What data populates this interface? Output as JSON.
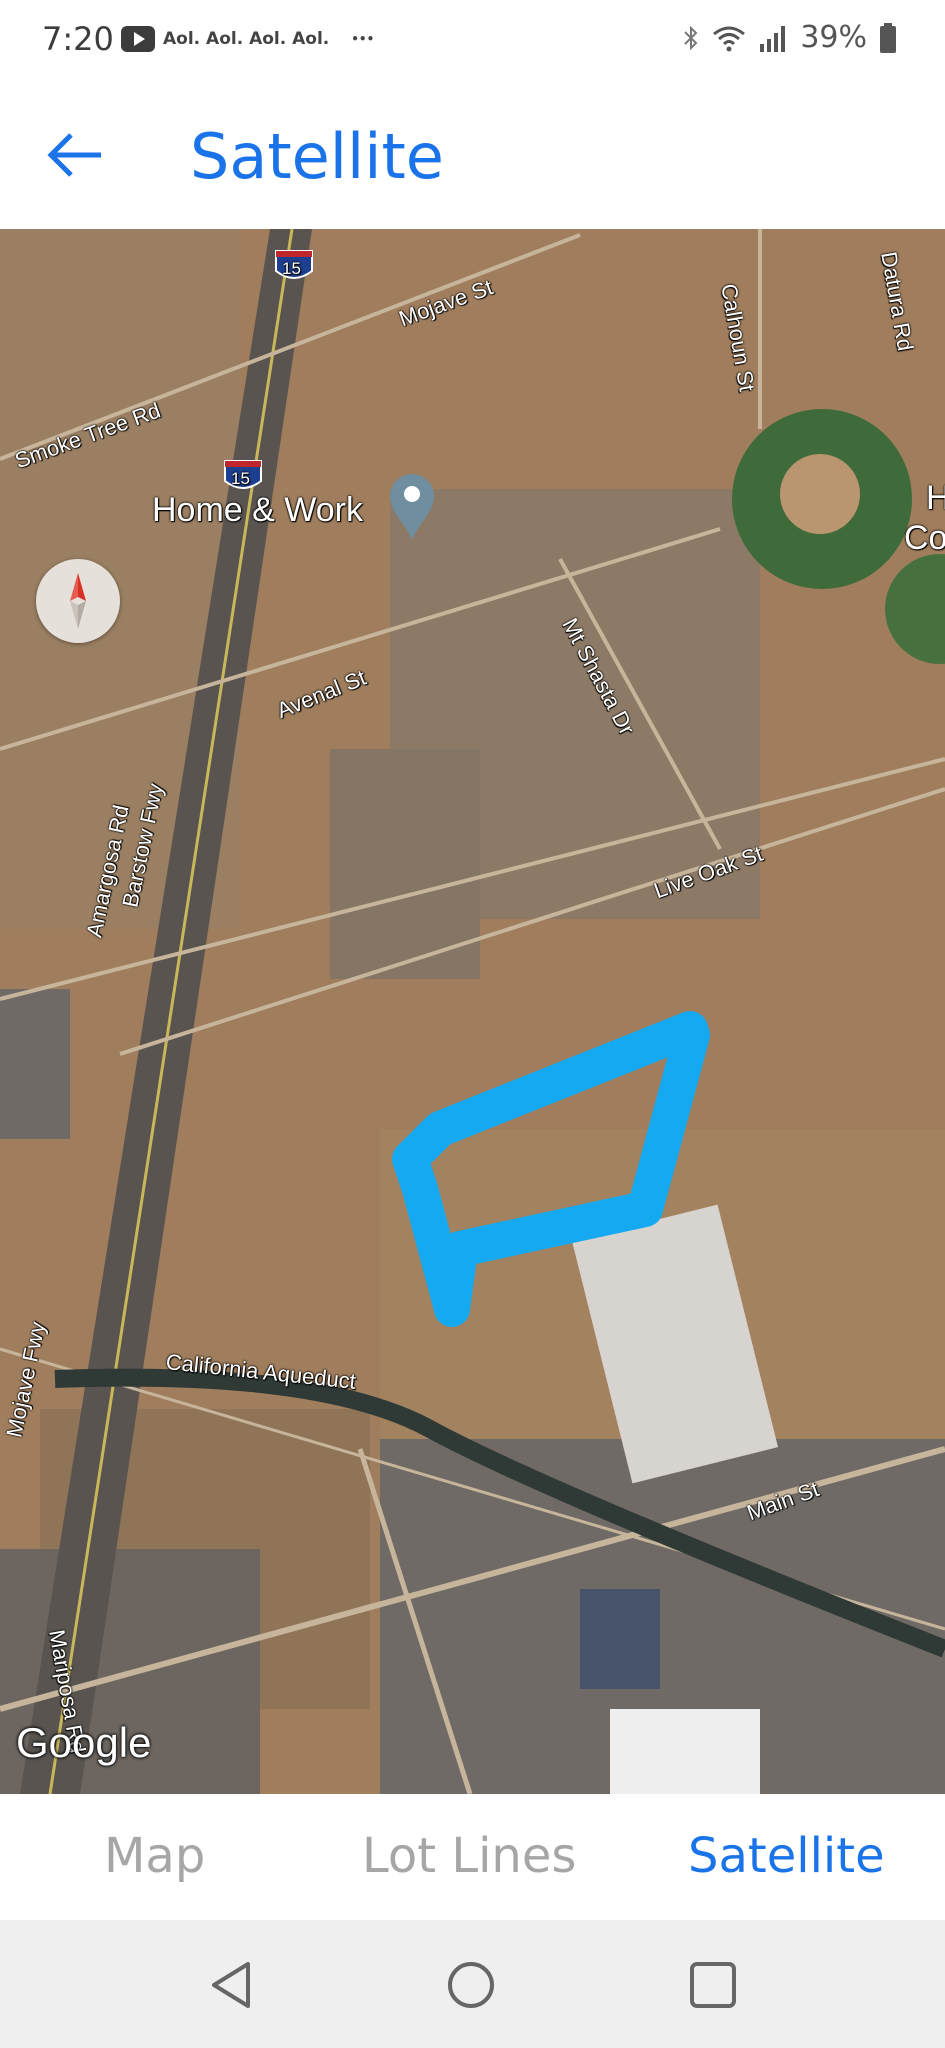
{
  "status": {
    "time": "7:20",
    "notification_apps": "Aol. Aol. Aol. Aol.",
    "more": "•••",
    "battery": "39%"
  },
  "header": {
    "title": "Satellite"
  },
  "map": {
    "roads": {
      "mojave_st": "Mojave St",
      "smoke_tree": "Smoke Tree Rd",
      "calhoun": "Calhoun St",
      "datura": "Datura Rd",
      "avenal": "Avenal St",
      "mt_shasta": "Mt Shasta Dr",
      "live_oak": "Live Oak St",
      "amargosa": "Amargosa Rd",
      "barstow_fwy": "Barstow Fwy",
      "mojave_fwy": "Mojave Fwy",
      "aqueduct": "California Aqueduct",
      "main_st": "Main St",
      "mariposa": "Mariposa Rd"
    },
    "shield_1": "15",
    "shield_2": "15",
    "poi": "Home & Work",
    "poi_partial_1": "H",
    "poi_partial_2": "Co",
    "attribution": "Google"
  },
  "tabs": [
    {
      "label": "Map",
      "active": false
    },
    {
      "label": "Lot Lines",
      "active": false
    },
    {
      "label": "Satellite",
      "active": true
    }
  ],
  "colors": {
    "accent": "#1a73e8",
    "drawn_outline": "#14a9f0",
    "terrain": "#a07e5d"
  },
  "icons": [
    "back-arrow-icon",
    "compass-icon",
    "location-pin-icon",
    "nav-back-icon",
    "nav-home-icon",
    "nav-recents-icon"
  ]
}
